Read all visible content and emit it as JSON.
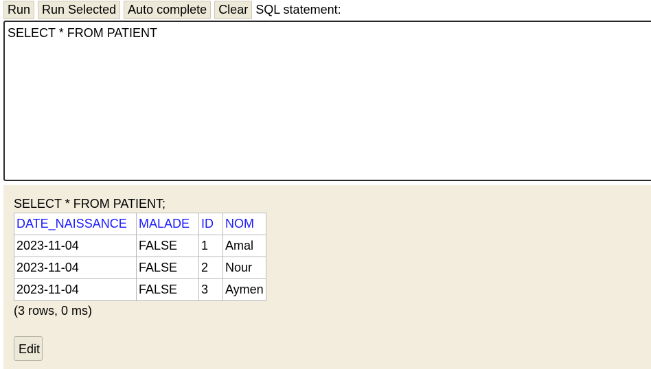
{
  "toolbar": {
    "run_label": "Run",
    "run_selected_label": "Run Selected",
    "auto_complete_label": "Auto complete",
    "clear_label": "Clear",
    "sql_statement_label": "SQL statement:"
  },
  "editor": {
    "text": "SELECT * FROM PATIENT"
  },
  "result": {
    "statement": "SELECT * FROM PATIENT;",
    "columns": [
      "DATE_NAISSANCE",
      "MALADE",
      "ID",
      "NOM"
    ],
    "rows": [
      [
        "2023-11-04",
        "FALSE",
        "1",
        "Amal"
      ],
      [
        "2023-11-04",
        "FALSE",
        "2",
        "Nour"
      ],
      [
        "2023-11-04",
        "FALSE",
        "3",
        "Aymen"
      ]
    ],
    "status": "(3 rows, 0 ms)",
    "edit_label": "Edit"
  },
  "colors": {
    "header_text": "#1a1aff",
    "result_background": "#f2eddd",
    "button_background": "#ece9d8"
  }
}
